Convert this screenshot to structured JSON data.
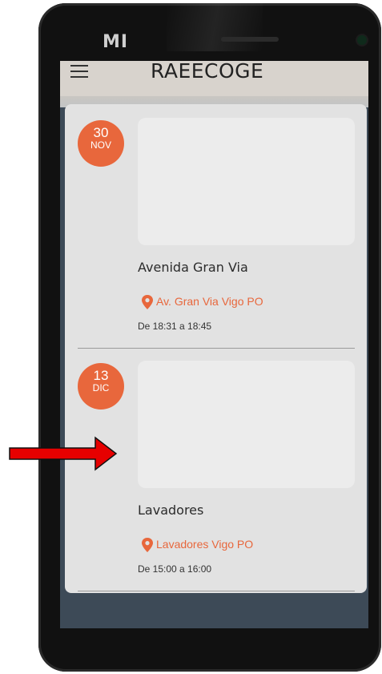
{
  "device": {
    "brand": "MI"
  },
  "app": {
    "title": "RAEECOGE"
  },
  "events": [
    {
      "day": "30",
      "month": "NOV",
      "title": "Avenida Gran Via",
      "location": "Av. Gran Via Vigo PO",
      "time": "De 18:31 a 18:45"
    },
    {
      "day": "13",
      "month": "DIC",
      "title": "Lavadores",
      "location": "Lavadores Vigo PO",
      "time": "De 15:00 a 16:00"
    }
  ],
  "colors": {
    "accent": "#e8673c",
    "annotation_arrow": "#e60000"
  },
  "icons": [
    "menu-icon",
    "location-pin-icon"
  ]
}
